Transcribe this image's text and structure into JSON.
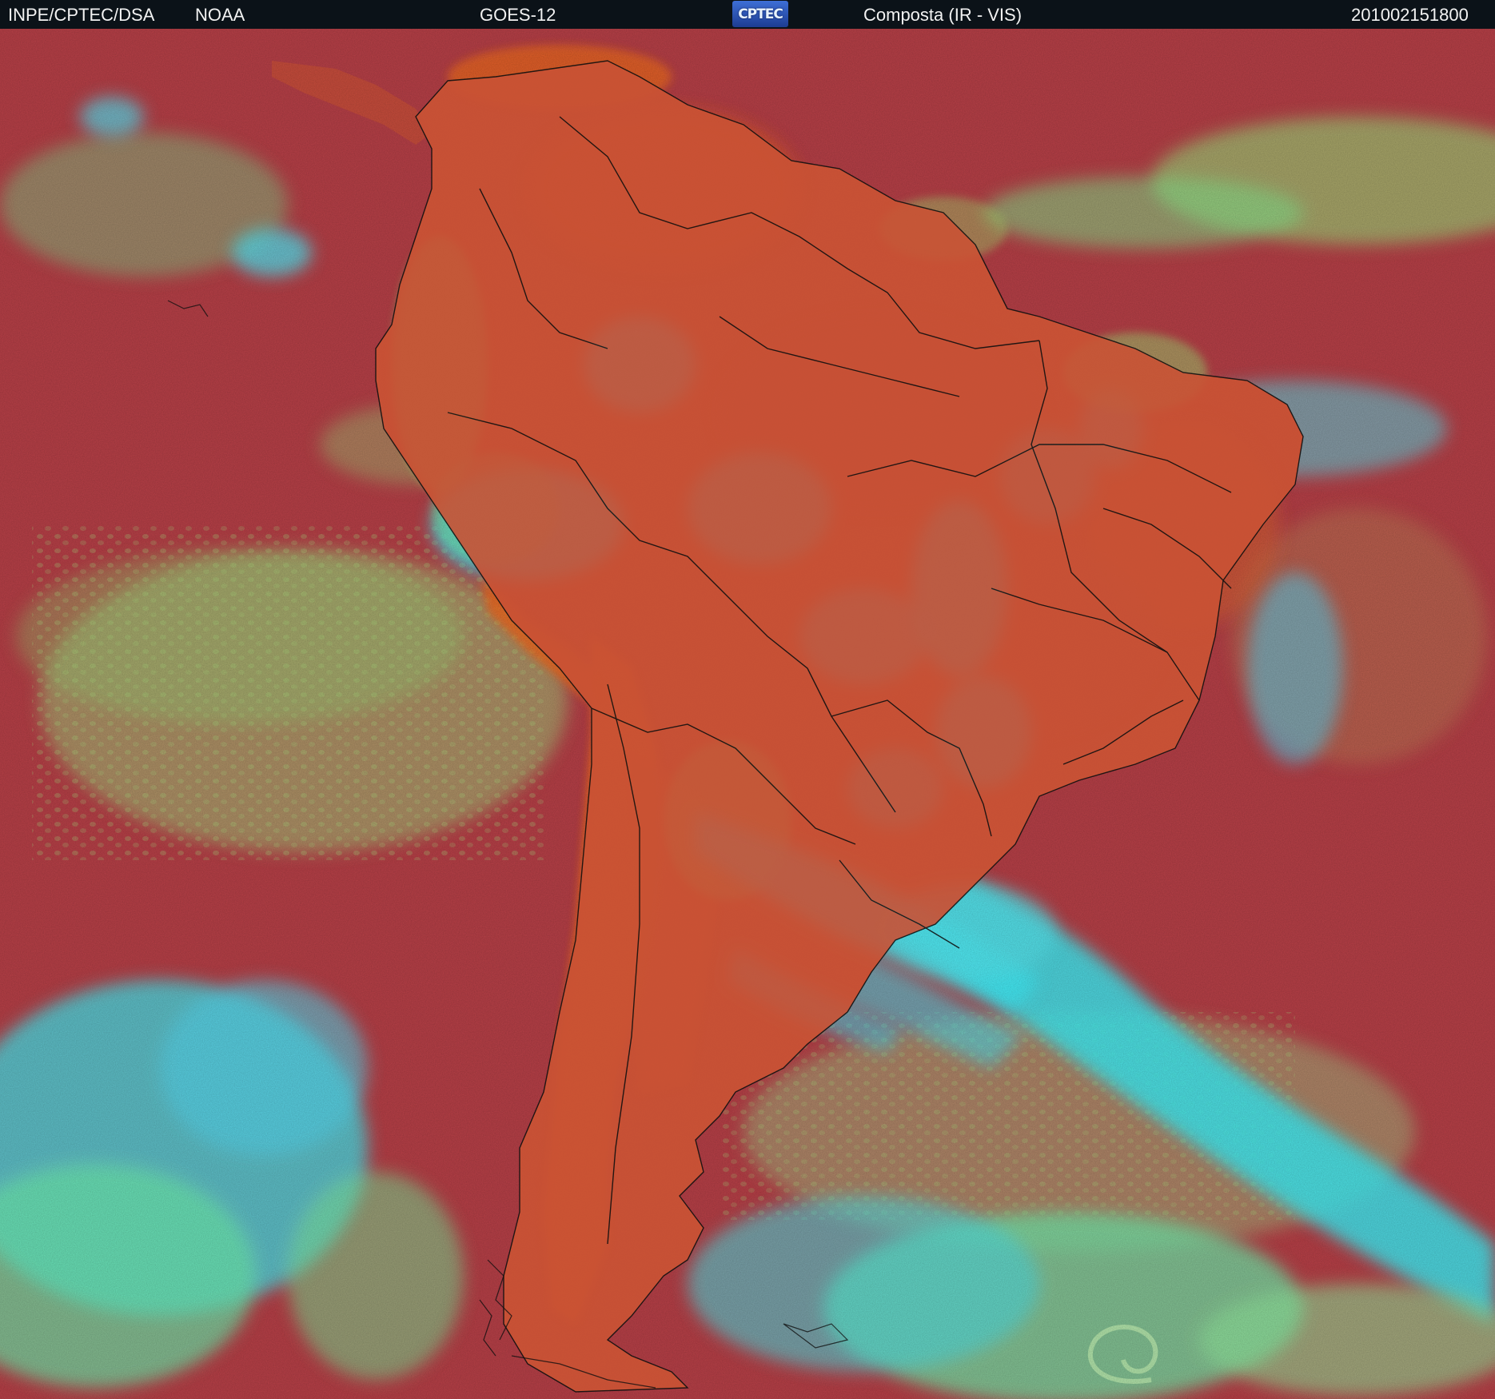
{
  "header": {
    "left_source": "INPE/CPTEC/DSA",
    "agency": "NOAA",
    "satellite": "GOES-12",
    "logo_text": "CPTEC",
    "product": "Composta (IR - VIS)",
    "timestamp": "201002151800"
  },
  "map": {
    "region": "South America",
    "colors": {
      "ocean_clear": "#b4403e",
      "land_clear": "#d8582c",
      "andes_desert": "#e66a22",
      "low_cloud": "#8fe07a",
      "high_cloud": "#34e6f0",
      "mid_cloud": "#4aa8e8",
      "borders": "#101010"
    }
  }
}
